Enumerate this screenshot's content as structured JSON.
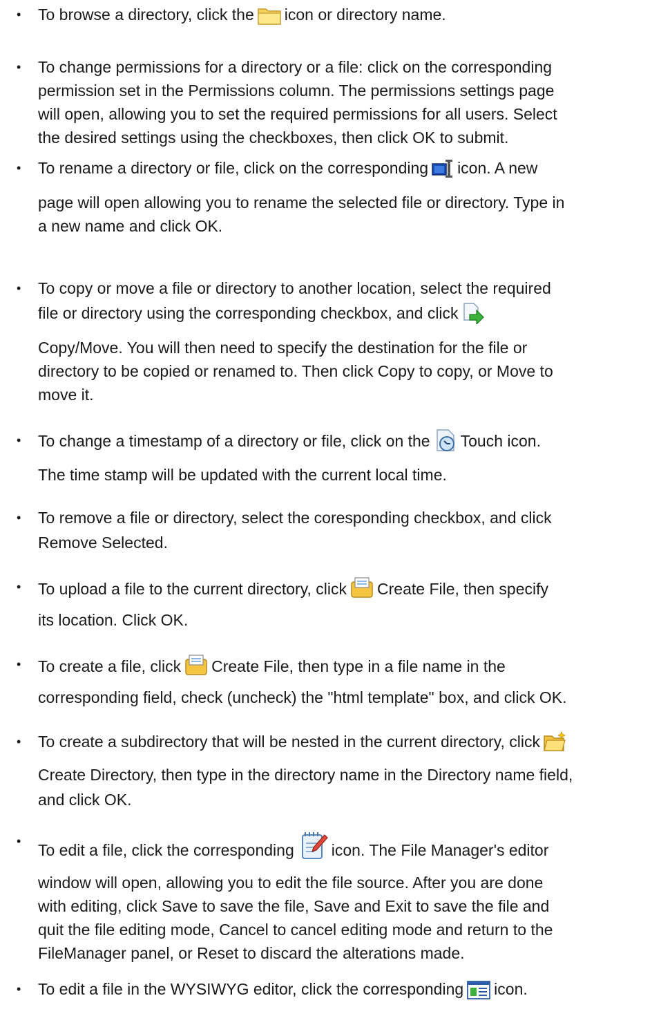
{
  "items": [
    {
      "lines": [
        [
          "To browse a directory, click the",
          {
            "icon": "folder-icon"
          },
          "icon or directory name."
        ]
      ]
    },
    {
      "lines": [
        [
          "To change permissions for a directory or a file: click on the corresponding"
        ],
        [
          "permission set in the Permissions column. The permissions settings page"
        ],
        [
          "will open, allowing you to set the required permissions for all users. Select"
        ],
        [
          "the desired settings using the checkboxes, then click OK to submit."
        ]
      ]
    },
    {
      "lines": [
        [
          "To rename a directory or file, click on the corresponding",
          {
            "icon": "rename-icon"
          },
          "icon. A new"
        ],
        [
          "page will open allowing you to rename the selected file or directory. Type in"
        ],
        [
          "a new name and click OK."
        ]
      ]
    },
    {
      "lines": [
        [
          "To copy or move a file or directory to another location, select the required"
        ],
        [
          "file or directory using the corresponding checkbox, and click",
          {
            "icon": "copy-move-icon"
          }
        ],
        [
          "Copy/Move. You will then need to specify the destination for the file or"
        ],
        [
          "directory to be copied or renamed to. Then click Copy to copy, or Move to"
        ],
        [
          "move it."
        ]
      ]
    },
    {
      "lines": [
        [
          "To change a timestamp of a directory or file, click on the",
          {
            "icon": "touch-clock-icon"
          },
          "Touch icon."
        ],
        [
          "The time stamp will be updated with the current local time."
        ]
      ]
    },
    {
      "lines": [
        [
          "To remove a file or directory, select the coresponding checkbox, and click"
        ],
        [
          "Remove Selected."
        ]
      ]
    },
    {
      "lines": [
        [
          "To upload a file to the current directory, click",
          {
            "icon": "create-file-icon"
          },
          "Create File, then specify"
        ],
        [
          "its location. Click OK."
        ]
      ]
    },
    {
      "lines": [
        [
          "To create a file, click",
          {
            "icon": "create-file-icon"
          },
          "Create File, then type in a file name in the"
        ],
        [
          "corresponding field, check (uncheck) the \"html template\" box, and click OK."
        ]
      ]
    },
    {
      "lines": [
        [
          "To create a subdirectory that will be nested in the current directory, click",
          {
            "icon": "create-directory-icon"
          }
        ],
        [
          "Create Directory, then type in the directory name in the Directory name field,"
        ],
        [
          "and click OK."
        ]
      ]
    },
    {
      "lines": [
        [
          "To edit a file, click the corresponding",
          {
            "icon": "edit-file-icon"
          },
          "icon. The File Manager's editor"
        ],
        [
          "window will open, allowing you to edit the file source. After you are done"
        ],
        [
          "with editing, click Save to save the file, Save and Exit to save the file and"
        ],
        [
          "quit the file editing mode, Cancel to cancel editing mode and return to the"
        ],
        [
          "FileManager panel, or Reset to discard the alterations made."
        ]
      ]
    },
    {
      "lines": [
        [
          "To edit a file in the WYSIWYG editor, click the corresponding",
          {
            "icon": "wysiwyg-editor-icon"
          },
          "icon."
        ]
      ]
    }
  ]
}
